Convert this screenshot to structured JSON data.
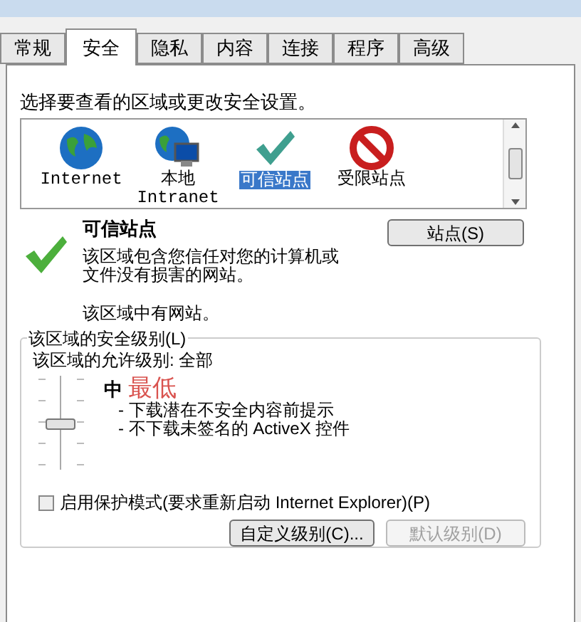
{
  "tabs": [
    {
      "label": "常规",
      "selected": false
    },
    {
      "label": "安全",
      "selected": true
    },
    {
      "label": "隐私",
      "selected": false
    },
    {
      "label": "内容",
      "selected": false
    },
    {
      "label": "连接",
      "selected": false
    },
    {
      "label": "程序",
      "selected": false
    },
    {
      "label": "高级",
      "selected": false
    }
  ],
  "prompt": "选择要查看的区域或更改安全设置。",
  "zones": [
    {
      "kind": "internet",
      "lines": [
        "Internet"
      ],
      "selected": false
    },
    {
      "kind": "intranet",
      "lines": [
        "本地",
        "Intranet"
      ],
      "selected": false
    },
    {
      "kind": "trusted",
      "lines": [
        "可信站点"
      ],
      "selected": true
    },
    {
      "kind": "restricted",
      "lines": [
        "受限站点"
      ],
      "selected": false
    }
  ],
  "zone_info": {
    "title": "可信站点",
    "description": "该区域包含您信任对您的计算机或文件没有损害的网站。",
    "note": "该区域中有网站。",
    "sites_button": "站点(S)"
  },
  "security_level": {
    "legend": "该区域的安全级别(L)",
    "allowed": "该区域的允许级别: 全部",
    "level": 0.5,
    "level_name": "中",
    "bullets": [
      "- 下载潜在不安全内容前提示",
      "- 不下载未签名的 ActiveX 控件"
    ],
    "protected_mode": {
      "label": "启用保护模式(要求重新启动 Internet Explorer)(P)",
      "checked": false
    },
    "buttons": [
      {
        "label": "自定义级别(C)...",
        "disabled": false
      },
      {
        "label": "默认级别(D)",
        "disabled": true
      }
    ]
  },
  "annotation": {
    "text": "最低"
  }
}
